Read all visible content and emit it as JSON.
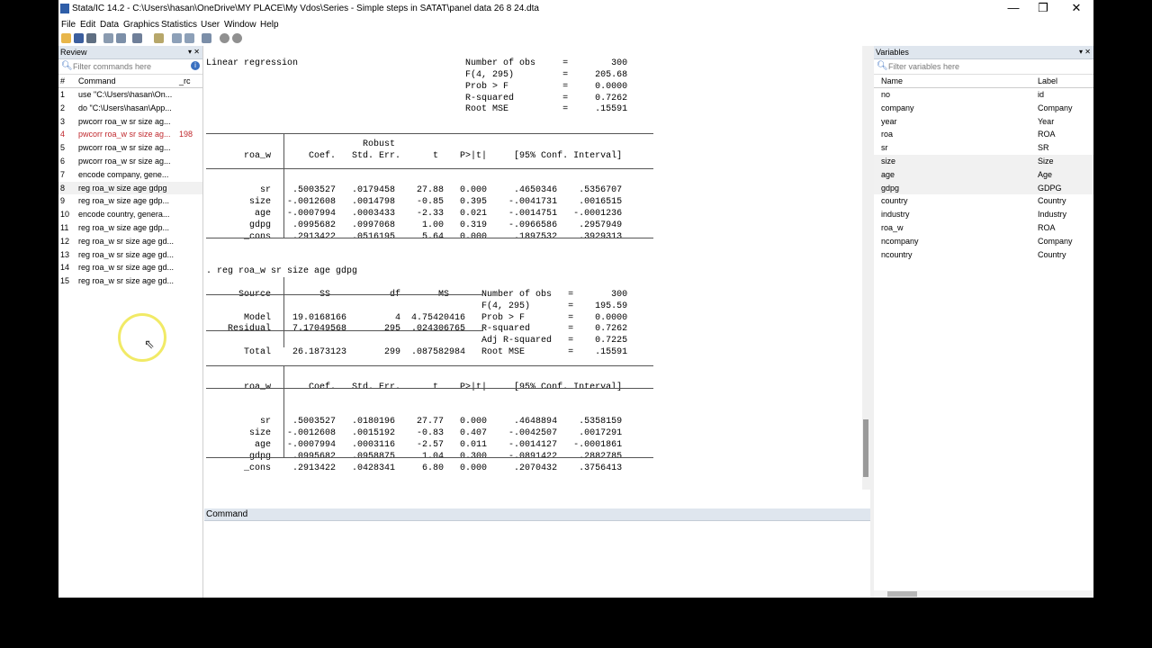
{
  "window": {
    "title": "Stata/IC 14.2 - C:\\Users\\hasan\\OneDrive\\MY PLACE\\My Vdos\\Series - Simple steps in SATAT\\panel data 26 8 24.dta",
    "minimize": "—",
    "maximize": "❐",
    "close": "✕"
  },
  "menu": [
    "File",
    "Edit",
    "Data",
    "Graphics",
    "Statistics",
    "User",
    "Window",
    "Help"
  ],
  "review": {
    "title": "Review",
    "filter_placeholder": "Filter commands here",
    "col_num": "#",
    "col_command": "Command",
    "col_rc": "_rc",
    "rows": [
      {
        "n": "1",
        "cmd": "use \"C:\\Users\\hasan\\On...",
        "rc": ""
      },
      {
        "n": "2",
        "cmd": "do \"C:\\Users\\hasan\\App...",
        "rc": ""
      },
      {
        "n": "3",
        "cmd": "pwcorr roa_w sr size ag...",
        "rc": ""
      },
      {
        "n": "4",
        "cmd": "pwcorr roa_w sr size ag...",
        "rc": "198"
      },
      {
        "n": "5",
        "cmd": "pwcorr roa_w sr size ag...",
        "rc": ""
      },
      {
        "n": "6",
        "cmd": "pwcorr roa_w sr size ag...",
        "rc": ""
      },
      {
        "n": "7",
        "cmd": "encode company, gene...",
        "rc": ""
      },
      {
        "n": "8",
        "cmd": "reg roa_w size age gdpg",
        "rc": ""
      },
      {
        "n": "9",
        "cmd": "reg roa_w size age gdp...",
        "rc": ""
      },
      {
        "n": "10",
        "cmd": "encode country, genera...",
        "rc": ""
      },
      {
        "n": "11",
        "cmd": "reg roa_w size age gdp...",
        "rc": ""
      },
      {
        "n": "12",
        "cmd": "reg roa_w sr size age gd...",
        "rc": ""
      },
      {
        "n": "13",
        "cmd": "reg roa_w sr size age gd...",
        "rc": ""
      },
      {
        "n": "14",
        "cmd": "reg roa_w sr size age gd...",
        "rc": ""
      },
      {
        "n": "15",
        "cmd": "reg roa_w sr size age gd...",
        "rc": ""
      }
    ]
  },
  "results_text": "Linear regression                               Number of obs     =        300\n                                                F(4, 295)         =     205.68\n                                                Prob > F          =     0.0000\n                                                R-squared         =     0.7262\n                                                Root MSE          =     .15591\n\n\n                             Robust\n       roa_w       Coef.   Std. Err.      t    P>|t|     [95% Conf. Interval]\n\n\n          sr    .5003527   .0179458    27.88   0.000     .4650346    .5356707\n        size   -.0012608   .0014798    -0.85   0.395    -.0041731    .0016515\n         age   -.0007994   .0003433    -2.33   0.021    -.0014751   -.0001236\n        gdpg    .0995682   .0997068     1.00   0.319    -.0966586    .2957949\n       _cons    .2913422   .0516195     5.64   0.000     .1897532    .3929313\n\n\n. reg roa_w sr size age gdpg\n\n      Source         SS           df       MS      Number of obs   =       300\n                                                   F(4, 295)       =    195.59\n       Model    19.0168166         4  4.75420416   Prob > F        =    0.0000\n    Residual    7.17049568       295  .024306765   R-squared       =    0.7262\n                                                   Adj R-squared   =    0.7225\n       Total    26.1873123       299  .087582984   Root MSE        =    .15591\n\n\n       roa_w       Coef.   Std. Err.      t    P>|t|     [95% Conf. Interval]\n\n\n          sr    .5003527   .0180196    27.77   0.000     .4648894    .5358159\n        size   -.0012608   .0015192    -0.83   0.407    -.0042507    .0017291\n         age   -.0007994   .0003116    -2.57   0.011    -.0014127   -.0001861\n        gdpg    .0995682   .0958875     1.04   0.300    -.0891422    .2882785\n       _cons    .2913422   .0428341     6.80   0.000     .2070432    .3756413\n\n\n.",
  "command": {
    "title": "Command",
    "value": ""
  },
  "variables": {
    "title": "Variables",
    "filter_placeholder": "Filter variables here",
    "col_name": "Name",
    "col_label": "Label",
    "rows": [
      {
        "name": "no",
        "label": "id"
      },
      {
        "name": "company",
        "label": "Company"
      },
      {
        "name": "year",
        "label": "Year"
      },
      {
        "name": "roa",
        "label": "ROA"
      },
      {
        "name": "sr",
        "label": "SR"
      },
      {
        "name": "size",
        "label": "Size"
      },
      {
        "name": "age",
        "label": "Age"
      },
      {
        "name": "gdpg",
        "label": "GDPG"
      },
      {
        "name": "country",
        "label": "Country"
      },
      {
        "name": "industry",
        "label": "Industry"
      },
      {
        "name": "roa_w",
        "label": "ROA"
      },
      {
        "name": "ncompany",
        "label": "Company"
      },
      {
        "name": "ncountry",
        "label": "Country"
      }
    ]
  }
}
